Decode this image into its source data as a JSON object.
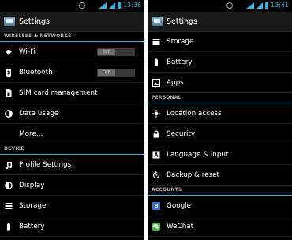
{
  "left": {
    "status": {
      "time": "13:36"
    },
    "title": "Settings",
    "sections": [
      {
        "header": "WIRELESS & NETWORKS",
        "items": [
          {
            "label": "Wi-Fi",
            "icon": "wifi-icon",
            "toggle": "OFF"
          },
          {
            "label": "Bluetooth",
            "icon": "bluetooth-icon",
            "toggle": "OFF"
          },
          {
            "label": "SIM card management",
            "icon": "sim-card-icon"
          },
          {
            "label": "Data usage",
            "icon": "data-usage-icon"
          },
          {
            "label": "More…"
          }
        ]
      },
      {
        "header": "DEVICE",
        "items": [
          {
            "label": "Profile Settings",
            "icon": "music-note-icon"
          },
          {
            "label": "Display",
            "icon": "display-icon"
          },
          {
            "label": "Storage",
            "icon": "storage-icon"
          },
          {
            "label": "Battery",
            "icon": "battery-icon"
          }
        ]
      }
    ]
  },
  "right": {
    "status": {
      "time": "13:41"
    },
    "title": "Settings",
    "items_top": [
      {
        "label": "Storage",
        "icon": "storage-icon"
      },
      {
        "label": "Battery",
        "icon": "battery-icon"
      },
      {
        "label": "Apps",
        "icon": "apps-icon"
      }
    ],
    "personal": {
      "header": "PERSONAL",
      "items": [
        {
          "label": "Location access",
          "icon": "location-icon"
        },
        {
          "label": "Security",
          "icon": "lock-icon"
        },
        {
          "label": "Language & input",
          "icon": "language-icon"
        },
        {
          "label": "Backup & reset",
          "icon": "backup-icon"
        }
      ]
    },
    "accounts": {
      "header": "ACCOUNTS",
      "items": [
        {
          "label": "Google",
          "icon": "google-icon",
          "glyph": "8"
        },
        {
          "label": "WeChat",
          "icon": "wechat-icon"
        }
      ]
    }
  },
  "colors": {
    "accent": "#33b5e5",
    "background": "#000000",
    "actionbar": "#1a1a1a"
  }
}
